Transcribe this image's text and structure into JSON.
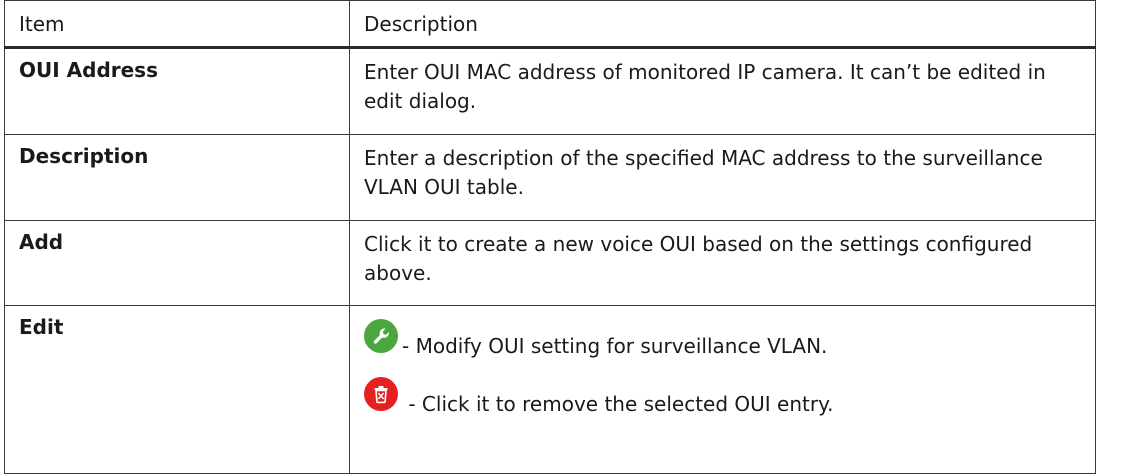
{
  "table": {
    "headers": {
      "item": "Item",
      "description": "Description"
    },
    "rows": [
      {
        "item": "OUI Address",
        "description": "Enter OUI MAC address of monitored IP camera. It can’t be edited in edit dialog."
      },
      {
        "item": "Description",
        "description": "Enter a description of the specified MAC address to the surveillance VLAN OUI table."
      },
      {
        "item": "Add",
        "description": "Click it to create a new voice OUI based on the settings configured above."
      },
      {
        "item": "Edit",
        "edit_text": "- Modify OUI setting for surveillance VLAN.",
        "delete_text": " - Click it to remove the selected OUI entry.",
        "edit_icon": "wrench-icon",
        "delete_icon": "trash-icon"
      }
    ]
  },
  "colors": {
    "edit_icon_bg": "#4aa63e",
    "delete_icon_bg": "#e62020",
    "border": "#3a3a3a"
  }
}
